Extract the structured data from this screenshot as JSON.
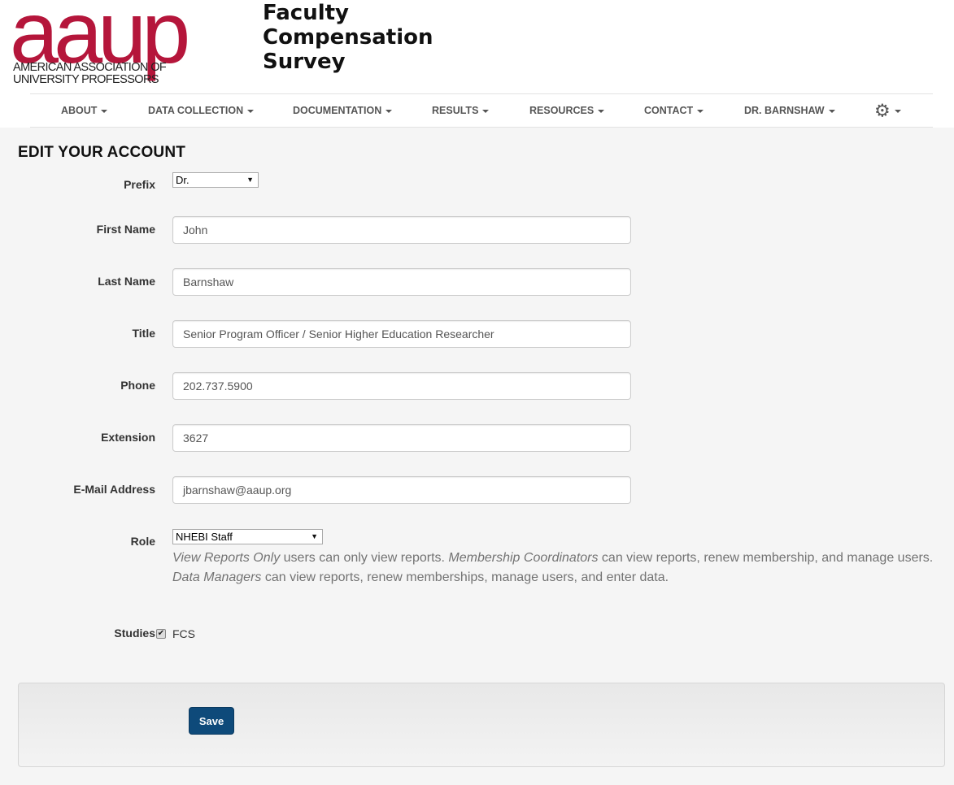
{
  "header": {
    "logo_text": "aaup",
    "logo_sub_line1": "AMERICAN ASSOCIATION OF",
    "logo_sub_line2": "UNIVERSITY PROFESSORS",
    "title_lines": [
      "Faculty",
      "Compensation",
      "Survey"
    ]
  },
  "nav": {
    "items": [
      {
        "label": "ABOUT"
      },
      {
        "label": "DATA COLLECTION"
      },
      {
        "label": "DOCUMENTATION"
      },
      {
        "label": "RESULTS"
      },
      {
        "label": "RESOURCES"
      },
      {
        "label": "CONTACT"
      },
      {
        "label": "DR. BARNSHAW"
      }
    ],
    "settings_icon": "gear-icon",
    "settings_glyph": "⚙"
  },
  "form": {
    "page_title": "EDIT YOUR ACCOUNT",
    "prefix": {
      "label": "Prefix",
      "value": "Dr."
    },
    "first_name": {
      "label": "First Name",
      "value": "John"
    },
    "last_name": {
      "label": "Last Name",
      "value": "Barnshaw"
    },
    "title": {
      "label": "Title",
      "value": "Senior Program Officer / Senior Higher Education Researcher"
    },
    "phone": {
      "label": "Phone",
      "value": "202.737.5900"
    },
    "extension": {
      "label": "Extension",
      "value": "3627"
    },
    "email": {
      "label": "E-Mail Address",
      "value": "jbarnshaw@aaup.org"
    },
    "role": {
      "label": "Role",
      "value": "NHEBI Staff",
      "help": {
        "view_only_em": "View Reports Only",
        "view_only_text": " users can only view reports. ",
        "membership_em": "Membership Coordinators",
        "membership_text": " can view reports, renew membership, and manage users.",
        "data_em": "Data Managers",
        "data_text": " can view reports, renew memberships, manage users, and enter data."
      }
    },
    "studies": {
      "label": "Studies",
      "option": "FCS",
      "checked": true,
      "check_glyph": "✔"
    },
    "save_label": "Save"
  },
  "colors": {
    "brand": "#b5163b",
    "save_button": "#0e4a7a",
    "background": "#f5f5f5"
  }
}
